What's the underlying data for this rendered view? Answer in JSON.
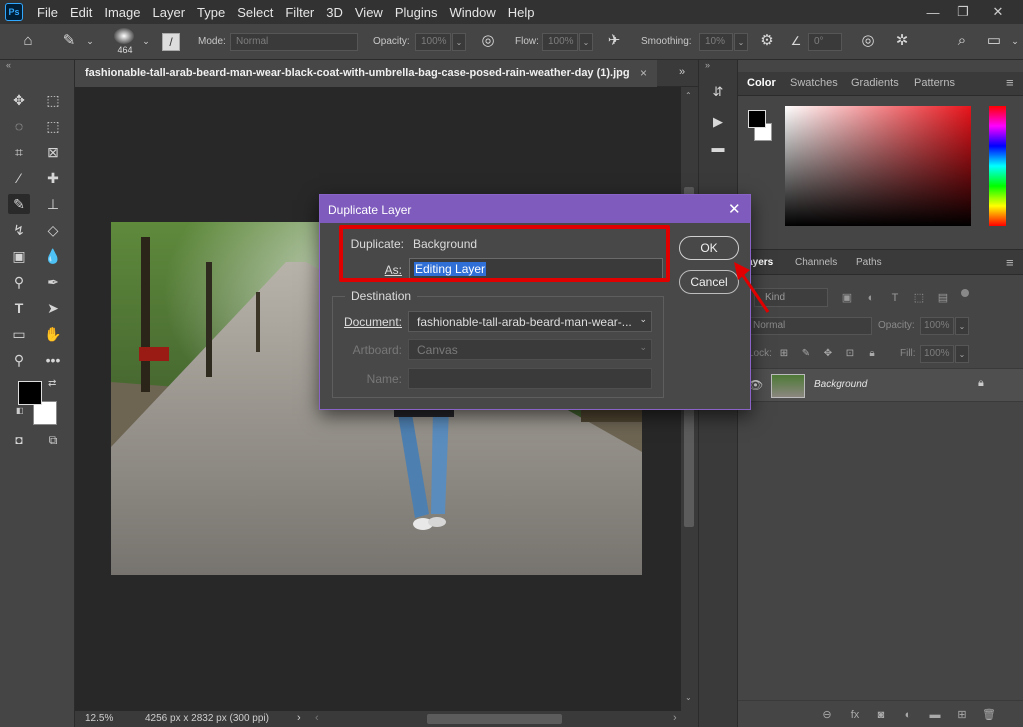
{
  "app": {
    "logo": "Ps"
  },
  "menu": [
    "File",
    "Edit",
    "Image",
    "Layer",
    "Type",
    "Select",
    "Filter",
    "3D",
    "View",
    "Plugins",
    "Window",
    "Help"
  ],
  "window_controls": {
    "minimize": "—",
    "restore": "❐",
    "close": "✕"
  },
  "options": {
    "brush_size": "464",
    "mode_label": "Mode:",
    "mode_value": "Normal",
    "opacity_label": "Opacity:",
    "opacity_value": "100%",
    "flow_label": "Flow:",
    "flow_value": "100%",
    "smoothing_label": "Smoothing:",
    "smoothing_value": "10%",
    "angle_value": "0°"
  },
  "document": {
    "tab_title": "fashionable-tall-arab-beard-man-wear-black-coat-with-umbrella-bag-case-posed-rain-weather-day (1).jpg",
    "close_glyph": "×",
    "zoom": "12.5%",
    "size_info": "4256 px x 2832 px (300 ppi)"
  },
  "panels": {
    "color_tabs": [
      "Color",
      "Swatches",
      "Gradients",
      "Patterns"
    ],
    "layer_tabs": [
      "Layers",
      "Channels",
      "Paths"
    ],
    "kind_label": "Kind",
    "blend_mode": "Normal",
    "opacity_label": "Opacity:",
    "opacity_value": "100%",
    "lock_label": "Lock:",
    "fill_label": "Fill:",
    "fill_value": "100%",
    "layer_name": "Background"
  },
  "dialog": {
    "title": "Duplicate Layer",
    "duplicate_label": "Duplicate:",
    "duplicate_value": "Background",
    "as_label": "As:",
    "as_value": "Editing Layer",
    "ok_label": "OK",
    "cancel_label": "Cancel",
    "destination_label": "Destination",
    "document_label": "Document:",
    "document_value": "fashionable-tall-arab-beard-man-wear-...",
    "artboard_label": "Artboard:",
    "artboard_value": "Canvas",
    "name_label": "Name:",
    "name_value": ""
  },
  "colors": {
    "accent_purple": "#7e5bbd",
    "highlight_red": "#e00000",
    "selection_blue": "#2f6fd6"
  }
}
